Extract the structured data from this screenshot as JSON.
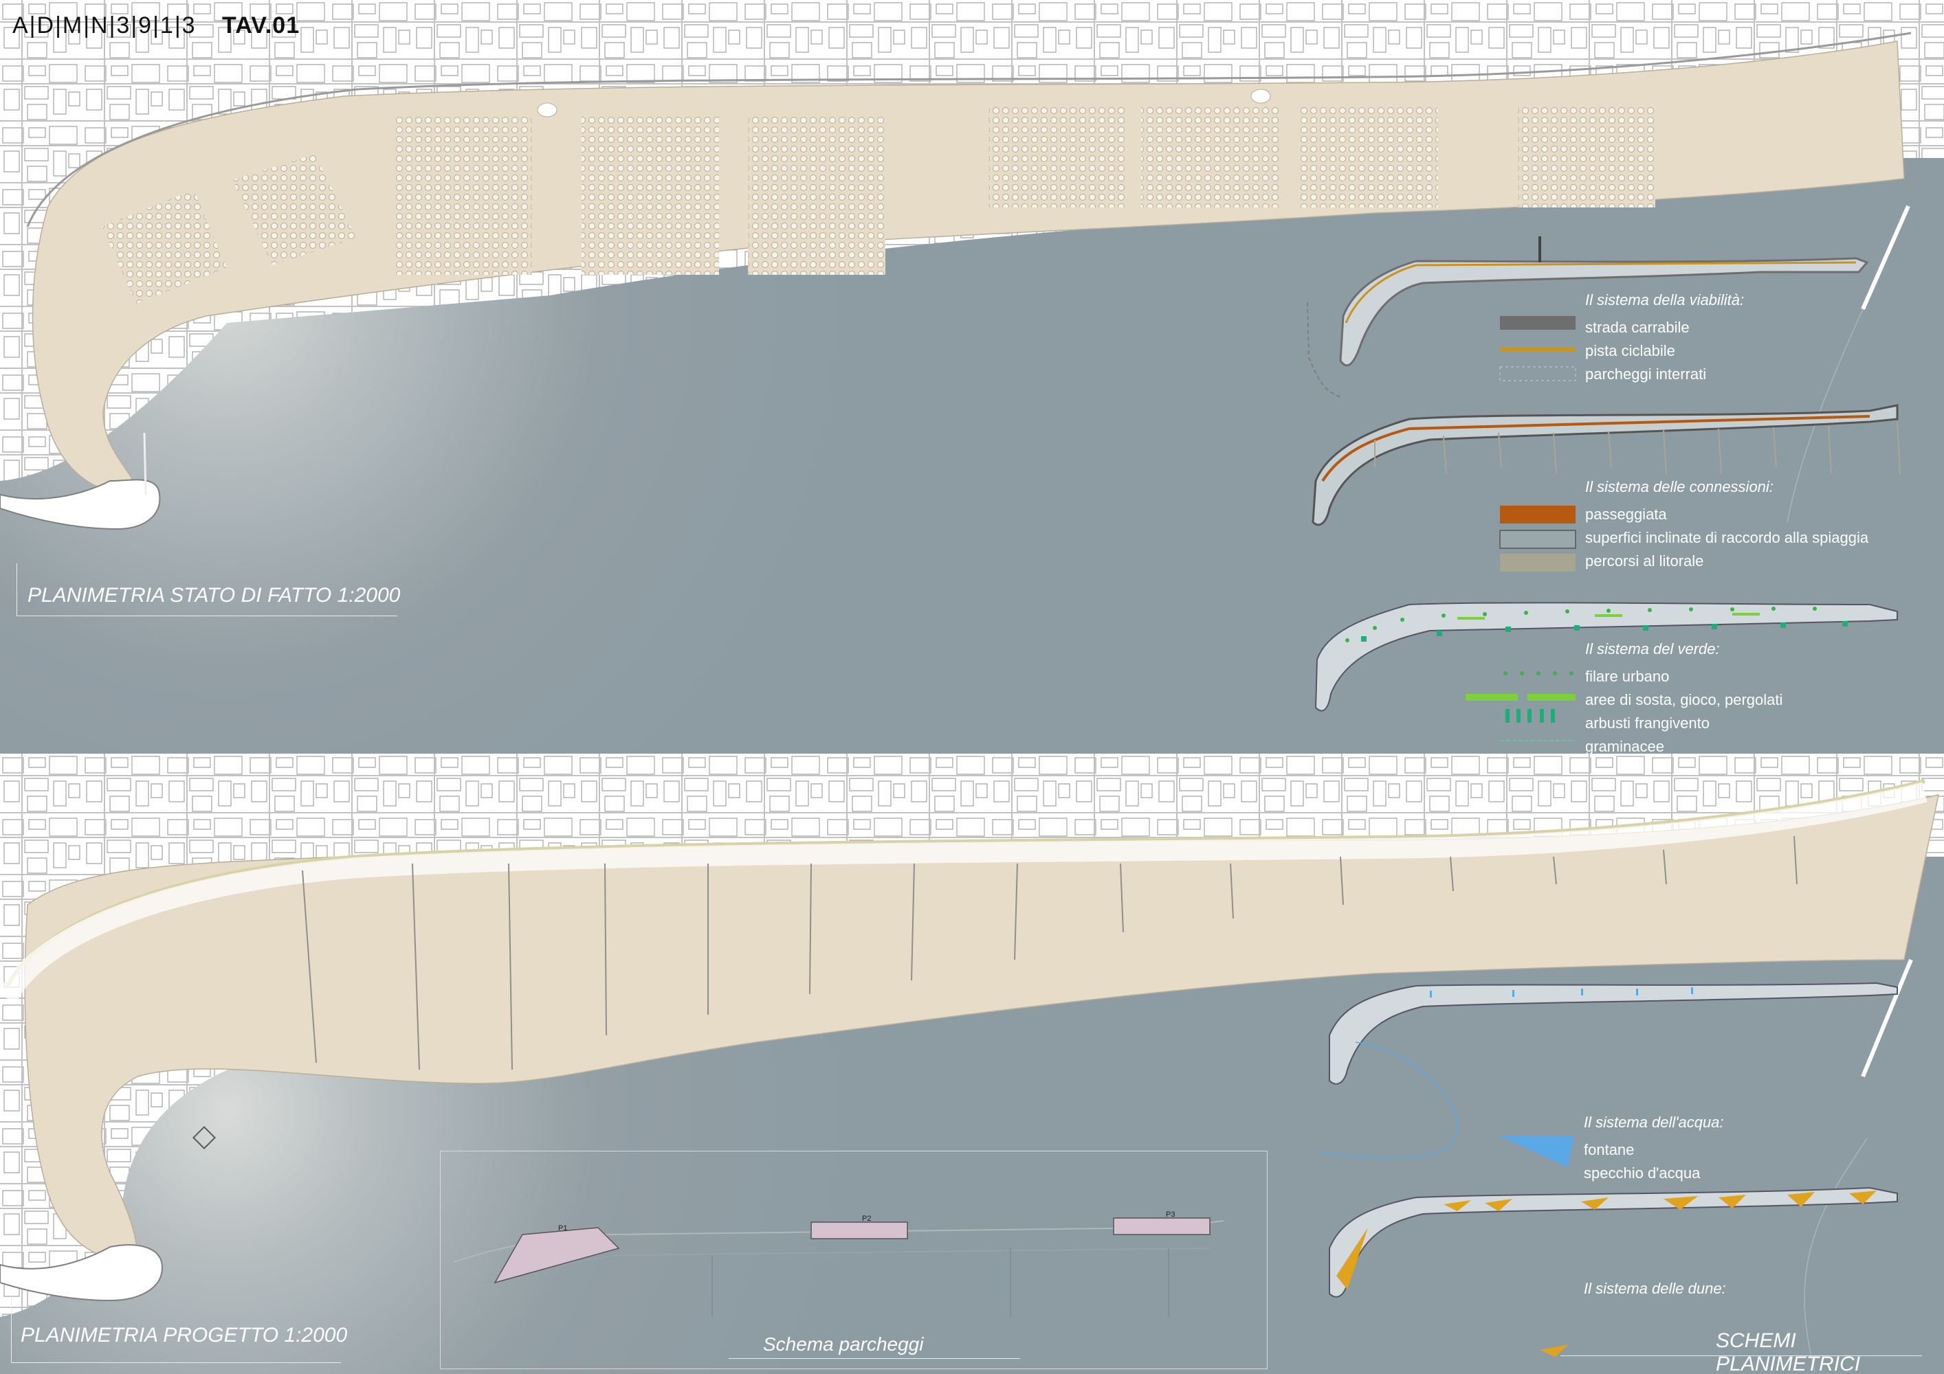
{
  "header": {
    "code": "A|D|M|N|3|9|1|3",
    "tav": "TAV.01"
  },
  "titles": {
    "stato_di_fatto": "PLANIMETRIA STATO DI FATTO 1:2000",
    "progetto": "PLANIMETRIA PROGETTO 1:2000",
    "schema_parcheggi": "Schema parcheggi",
    "schemi_planimetrici": "SCHEMI PLANIMETRICI"
  },
  "colors": {
    "sea": "#8d9ca3",
    "sand": "#e7dcc7",
    "land": "#ffffff",
    "lines": "#9a9a9a",
    "road": "#6e6e6e",
    "bike": "#c9931f",
    "promenade": "#b65a12",
    "green": "#3bb24a",
    "water": "#5aa8e6",
    "dune": "#e0a31d"
  },
  "legends": {
    "viabilita": {
      "heading": "Il sistema della viabilità:",
      "items": [
        {
          "label": "strada carrabile",
          "color": "#6e6e6e"
        },
        {
          "label": "pista ciclabile",
          "color": "#c9931f"
        },
        {
          "label": "parcheggi interrati",
          "color": "#8d9ca3"
        }
      ]
    },
    "connessioni": {
      "heading": "Il sistema delle connessioni:",
      "items": [
        {
          "label": "passeggiata",
          "color": "#b65a12"
        },
        {
          "label": "superfici inclinate di raccordo alla spiaggia",
          "color": "#9aa7ad"
        },
        {
          "label": "percorsi al litorale",
          "color": "#a8a593"
        }
      ]
    },
    "verde": {
      "heading": "Il sistema del verde:",
      "items": [
        {
          "label": "filare urbano",
          "color": "#3bb24a"
        },
        {
          "label": "aree di sosta, gioco, pergolati",
          "color": "#7cd13a"
        },
        {
          "label": "arbusti frangivento",
          "color": "#1fae7a"
        },
        {
          "label": "graminacee",
          "color": "#6fbf9a"
        }
      ]
    },
    "acqua": {
      "heading": "Il sistema dell'acqua:",
      "items": [
        {
          "label": "fontane",
          "color": "#5aa8e6"
        },
        {
          "label": "specchio d'acqua",
          "color": "#5aa8e6"
        }
      ]
    },
    "dune": {
      "heading": "Il sistema delle dune:",
      "items": []
    }
  },
  "parking_labels": [
    "P1",
    "P2",
    "P3"
  ]
}
